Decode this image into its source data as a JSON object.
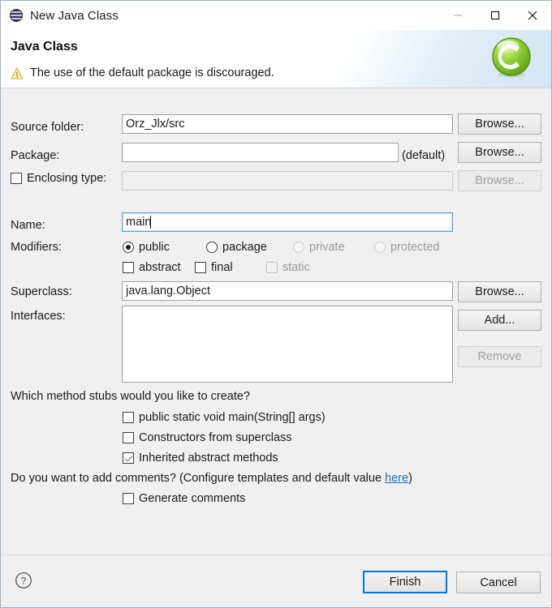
{
  "window": {
    "title": "New Java Class",
    "icon": "java-class-icon",
    "controls": {
      "minimize": "minimize-icon",
      "maximize": "maximize-icon",
      "close": "close-icon"
    }
  },
  "header": {
    "title": "Java Class",
    "message": "The use of the default package is discouraged.",
    "message_icon": "warning-icon",
    "logo": "eclipse-green-c-logo",
    "warning_color": "#f0c419",
    "accent_color": "#0078d7"
  },
  "form": {
    "source_folder": {
      "label": "Source folder:",
      "value": "Orz_Jlx/src",
      "browse_label": "Browse..."
    },
    "package": {
      "label": "Package:",
      "value": "",
      "suffix": "(default)",
      "browse_label": "Browse..."
    },
    "enclosing_type": {
      "label": "Enclosing type:",
      "checked": false,
      "value": "",
      "browse_label": "Browse...",
      "enabled": false
    },
    "name": {
      "label": "Name:",
      "value": "main",
      "focused": true
    },
    "modifiers": {
      "label": "Modifiers:",
      "access": [
        {
          "label": "public",
          "selected": true,
          "enabled": true
        },
        {
          "label": "package",
          "selected": false,
          "enabled": true
        },
        {
          "label": "private",
          "selected": false,
          "enabled": false
        },
        {
          "label": "protected",
          "selected": false,
          "enabled": false
        }
      ],
      "flags": [
        {
          "label": "abstract",
          "checked": false,
          "enabled": true
        },
        {
          "label": "final",
          "checked": false,
          "enabled": true
        },
        {
          "label": "static",
          "checked": false,
          "enabled": false
        }
      ]
    },
    "superclass": {
      "label": "Superclass:",
      "value": "java.lang.Object",
      "browse_label": "Browse..."
    },
    "interfaces": {
      "label": "Interfaces:",
      "items": [],
      "add_label": "Add...",
      "remove_label": "Remove",
      "remove_enabled": false
    }
  },
  "stubs": {
    "question": "Which method stubs would you like to create?",
    "options": [
      {
        "label": "public static void main(String[] args)",
        "checked": false
      },
      {
        "label": "Constructors from superclass",
        "checked": false
      },
      {
        "label": "Inherited abstract methods",
        "checked": true
      }
    ]
  },
  "comments": {
    "question_prefix": "Do you want to add comments? (Configure templates and default value ",
    "link_label": "here",
    "question_suffix": ")",
    "option": {
      "label": "Generate comments",
      "checked": false
    }
  },
  "footer": {
    "help_icon": "help-question-icon",
    "finish_label": "Finish",
    "cancel_label": "Cancel"
  }
}
